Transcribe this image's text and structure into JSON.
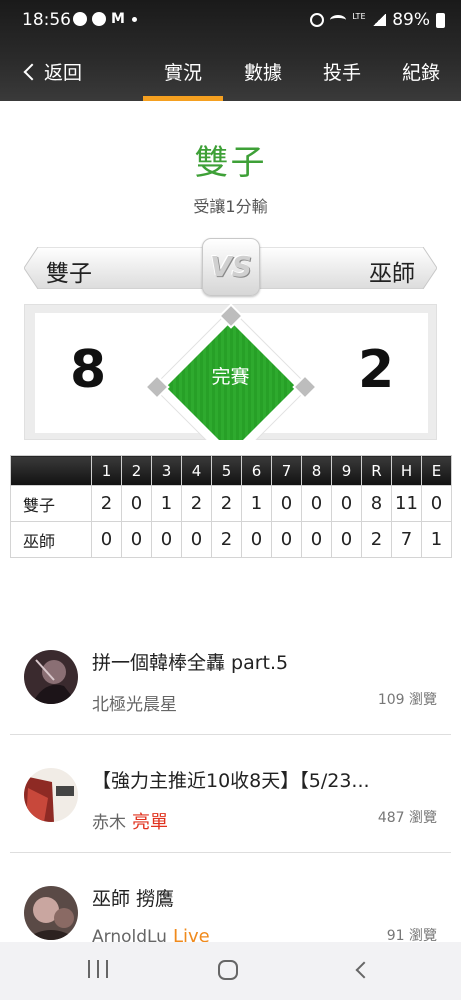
{
  "status_bar": {
    "time": "18:56",
    "battery": "89%",
    "network": "LTE"
  },
  "nav": {
    "back_label": "返回",
    "tabs": [
      {
        "label": "實況",
        "active": true
      },
      {
        "label": "數據",
        "active": false
      },
      {
        "label": "投手",
        "active": false
      },
      {
        "label": "紀錄",
        "active": false
      }
    ]
  },
  "header": {
    "team_title": "雙子",
    "handicap": "受讓1分輸"
  },
  "matchup": {
    "home_team": "雙子",
    "vs_label": "VS",
    "away_team": "巫師",
    "home_score": "8",
    "away_score": "2",
    "status": "完賽"
  },
  "linescore": {
    "headers": [
      "",
      "1",
      "2",
      "3",
      "4",
      "5",
      "6",
      "7",
      "8",
      "9",
      "R",
      "H",
      "E"
    ],
    "rows": [
      {
        "team": "雙子",
        "cells": [
          "2",
          "0",
          "1",
          "2",
          "2",
          "1",
          "0",
          "0",
          "0",
          "8",
          "11",
          "0"
        ]
      },
      {
        "team": "巫師",
        "cells": [
          "0",
          "0",
          "0",
          "0",
          "2",
          "0",
          "0",
          "0",
          "0",
          "2",
          "7",
          "1"
        ]
      }
    ]
  },
  "posts": [
    {
      "title": "拼一個韓棒全轟 part.5",
      "author": "北極光晨星",
      "tag": "",
      "views": "109 瀏覽"
    },
    {
      "title": "【強力主推近10收8天】【5/23...",
      "author": "赤木",
      "tag": "亮單",
      "views": "487 瀏覽"
    },
    {
      "title": "巫師 撈鷹",
      "author": "ArnoldLu",
      "tag": "Live",
      "views": "91 瀏覽"
    }
  ],
  "colors": {
    "accent_orange": "#f5a020",
    "team_green": "#3ea037",
    "field_green": "#2eaa2e",
    "tag_red": "#e0321e",
    "tag_orange": "#f08a1c"
  }
}
